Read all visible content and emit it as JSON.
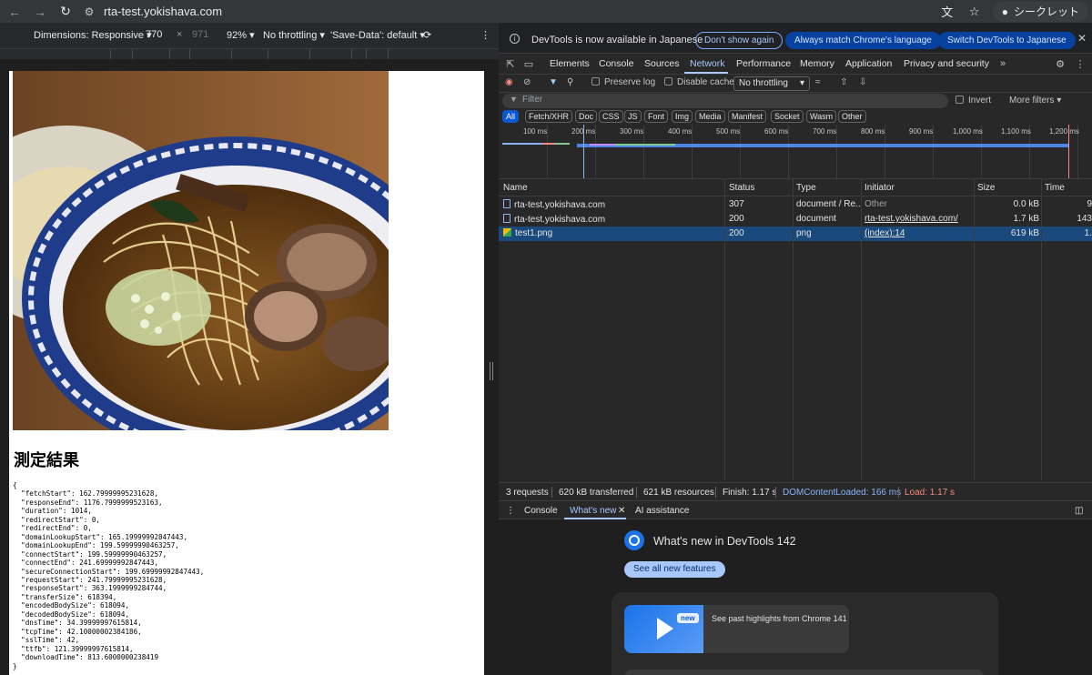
{
  "browser": {
    "url": "rta-test.yokishava.com",
    "incognito_label": "シークレット"
  },
  "device_toolbar": {
    "dimensions_label": "Dimensions: Responsive",
    "width": "770",
    "times": "×",
    "height": "971",
    "zoom": "92%",
    "throttling": "No throttling",
    "save_data": "'Save-Data': default"
  },
  "page": {
    "heading": "測定結果",
    "json_text": "{\n  \"fetchStart\": 162.79999995231628,\n  \"responseEnd\": 1176.7999999523163,\n  \"duration\": 1014,\n  \"redirectStart\": 0,\n  \"redirectEnd\": 0,\n  \"domainLookupStart\": 165.19999992847443,\n  \"domainLookupEnd\": 199.59999990463257,\n  \"connectStart\": 199.59999990463257,\n  \"connectEnd\": 241.69999992847443,\n  \"secureConnectionStart\": 199.69999992847443,\n  \"requestStart\": 241.79999995231628,\n  \"responseStart\": 363.1999999284744,\n  \"transferSize\": 618394,\n  \"encodedBodySize\": 618094,\n  \"decodedBodySize\": 618094,\n  \"dnsTime\": 34.39999997615814,\n  \"tcpTime\": 42.10000002384186,\n  \"sslTime\": 42,\n  \"ttfb\": 121.39999997615814,\n  \"downloadTime\": 813.6000000238419\n}"
  },
  "devtools": {
    "infobar": {
      "message": "DevTools is now available in Japanese",
      "dont_show": "Don't show again",
      "always_match": "Always match Chrome's language",
      "switch": "Switch DevTools to Japanese"
    },
    "tabs": [
      "Elements",
      "Console",
      "Sources",
      "Network",
      "Performance",
      "Memory",
      "Application",
      "Privacy and security"
    ],
    "network_toolbar": {
      "preserve_log": "Preserve log",
      "disable_cache": "Disable cache",
      "throttling": "No throttling"
    },
    "filter": {
      "placeholder": "Filter",
      "invert": "Invert",
      "more_filters": "More filters"
    },
    "type_filters": [
      "All",
      "Fetch/XHR",
      "Doc",
      "CSS",
      "JS",
      "Font",
      "Img",
      "Media",
      "Manifest",
      "Socket",
      "Wasm",
      "Other"
    ],
    "timeline_labels": [
      "100 ms",
      "200 ms",
      "300 ms",
      "400 ms",
      "500 ms",
      "600 ms",
      "700 ms",
      "800 ms",
      "900 ms",
      "1,000 ms",
      "1,100 ms",
      "1,200 ms"
    ],
    "columns": {
      "name": "Name",
      "status": "Status",
      "type": "Type",
      "initiator": "Initiator",
      "size": "Size",
      "time": "Time"
    },
    "requests": [
      {
        "name": "rta-test.yokishava.com",
        "status": "307",
        "type": "document / Re...",
        "initiator": "Other",
        "size": "0.0 kB",
        "time": "9"
      },
      {
        "name": "rta-test.yokishava.com",
        "status": "200",
        "type": "document",
        "initiator": "rta-test.yokishava.com/",
        "size": "1.7 kB",
        "time": "143"
      },
      {
        "name": "test1.png",
        "status": "200",
        "type": "png",
        "initiator": "(index):14",
        "size": "619 kB",
        "time": "1."
      }
    ],
    "summary": {
      "requests": "3 requests",
      "transferred": "620 kB transferred",
      "resources": "621 kB resources",
      "finish": "Finish: 1.17 s",
      "dom_content_loaded": "DOMContentLoaded: 166 ms",
      "load": "Load: 1.17 s"
    },
    "drawer": {
      "console_tab": "Console",
      "whats_new_tab": "What's new",
      "ai_tab": "AI assistance",
      "whats_new_title": "What's new in DevTools 142",
      "see_all": "See all new features",
      "new_badge": "new",
      "highlight_text": "See past highlights from Chrome 141"
    },
    "colors": {
      "accent": "#a8c7fa",
      "dcl": "#8ab4f8",
      "load": "#f28b82",
      "selected_row": "#1a4a7d"
    }
  }
}
